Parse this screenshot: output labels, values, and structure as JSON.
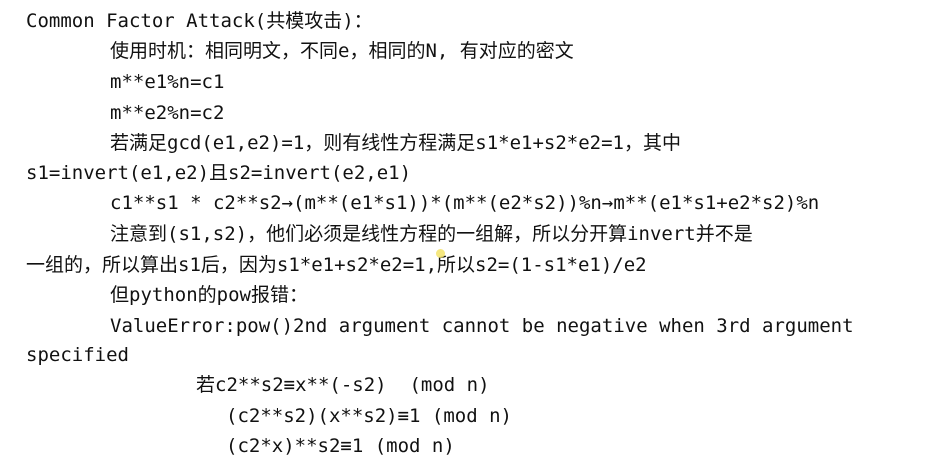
{
  "document": {
    "lines": [
      "Common Factor Attack(共模攻击)：",
      "使用时机：相同明文，不同e，相同的N, 有对应的密文",
      "m**e1%n=c1",
      "m**e2%n=c2",
      "若满足gcd(e1,e2)=1，则有线性方程满足s1*e1+s2*e2=1，其中",
      "s1=invert(e1,e2)且s2=invert(e2,e1)",
      "c1**s1 * c2**s2→(m**(e1*s1))*(m**(e2*s2))%n→m**(e1*s1+e2*s2)%n",
      "注意到(s1,s2)，他们必须是线性方程的一组解，所以分开算invert并不是",
      "一组的，所以算出s1后，因为s1*e1+s2*e2=1,所以s2=(1-s1*e1)/e2",
      "但python的pow报错：",
      "ValueError:pow()2nd argument cannot be negative when 3rd argument",
      "specified",
      "若c2**s2≡x**(-s2)  (mod n)",
      "(c2**s2)(x**s2)≡1 (mod n)",
      "(c2*x)**s2≡1 (mod n)"
    ]
  }
}
